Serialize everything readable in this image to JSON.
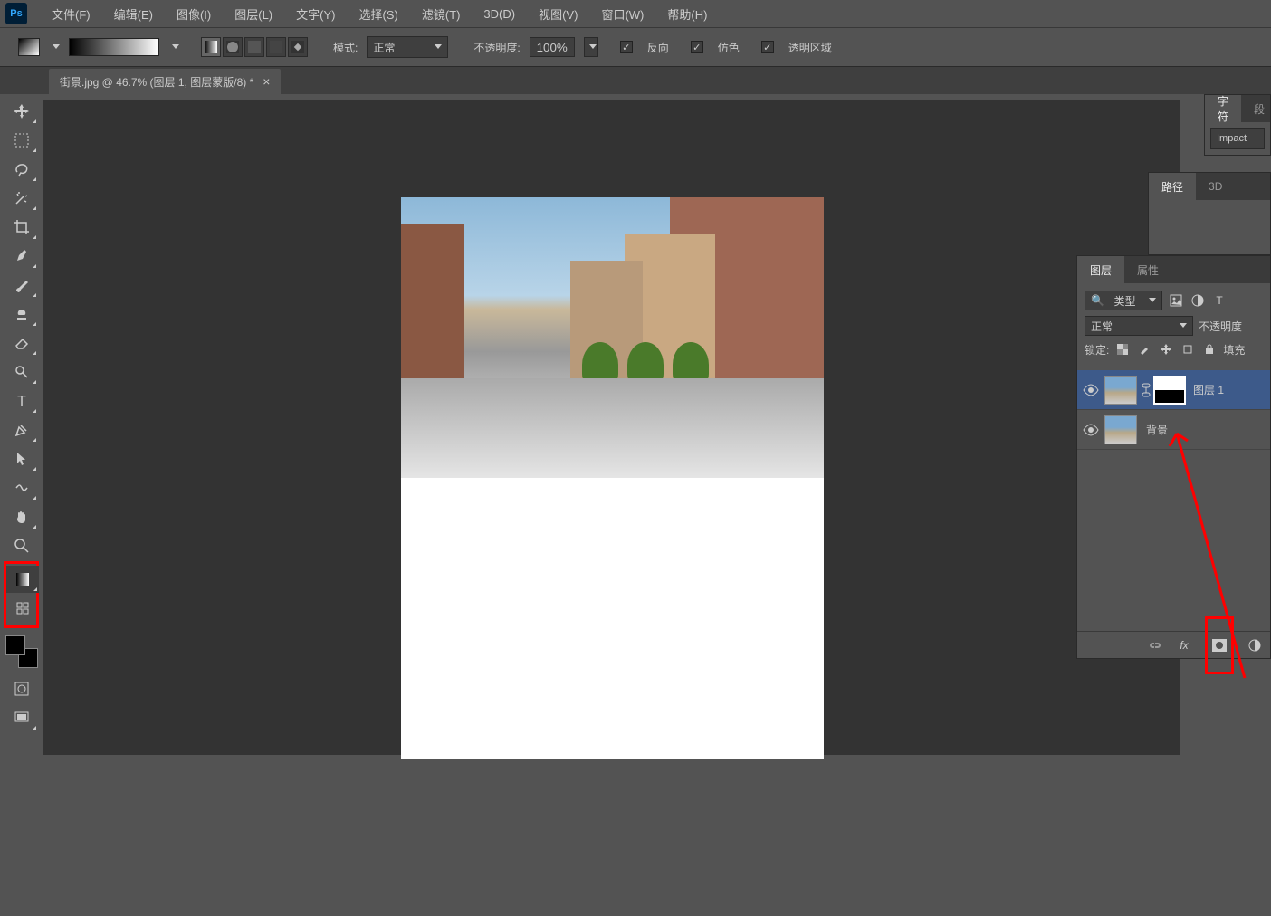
{
  "menu": {
    "file": "文件(F)",
    "edit": "编辑(E)",
    "image": "图像(I)",
    "layer": "图层(L)",
    "type": "文字(Y)",
    "select": "选择(S)",
    "filter": "滤镜(T)",
    "threeD": "3D(D)",
    "view": "视图(V)",
    "window": "窗口(W)",
    "help": "帮助(H)"
  },
  "options": {
    "mode_label": "模式:",
    "mode_value": "正常",
    "opacity_label": "不透明度:",
    "opacity_value": "100%",
    "reverse": "反向",
    "dither": "仿色",
    "transparency": "透明区域"
  },
  "document": {
    "tab_title": "街景.jpg @ 46.7% (图层 1, 图层蒙版/8) *",
    "close": "×"
  },
  "char_panel": {
    "tab": "字符",
    "tab2": "段",
    "font": "Impact"
  },
  "paths_panel": {
    "tab_paths": "路径",
    "tab_3d": "3D"
  },
  "layers_panel": {
    "tab_layers": "图层",
    "tab_props": "属性",
    "filter_label": "类型",
    "search_icon": "🔍",
    "blend_mode": "正常",
    "opacity_label": "不透明度",
    "lock_label": "锁定:",
    "fill_label": "填充",
    "layers": [
      {
        "name": "图层 1",
        "active": true,
        "has_mask": true
      },
      {
        "name": "背景",
        "active": false,
        "has_mask": false
      }
    ],
    "footer_fx": "fx"
  }
}
